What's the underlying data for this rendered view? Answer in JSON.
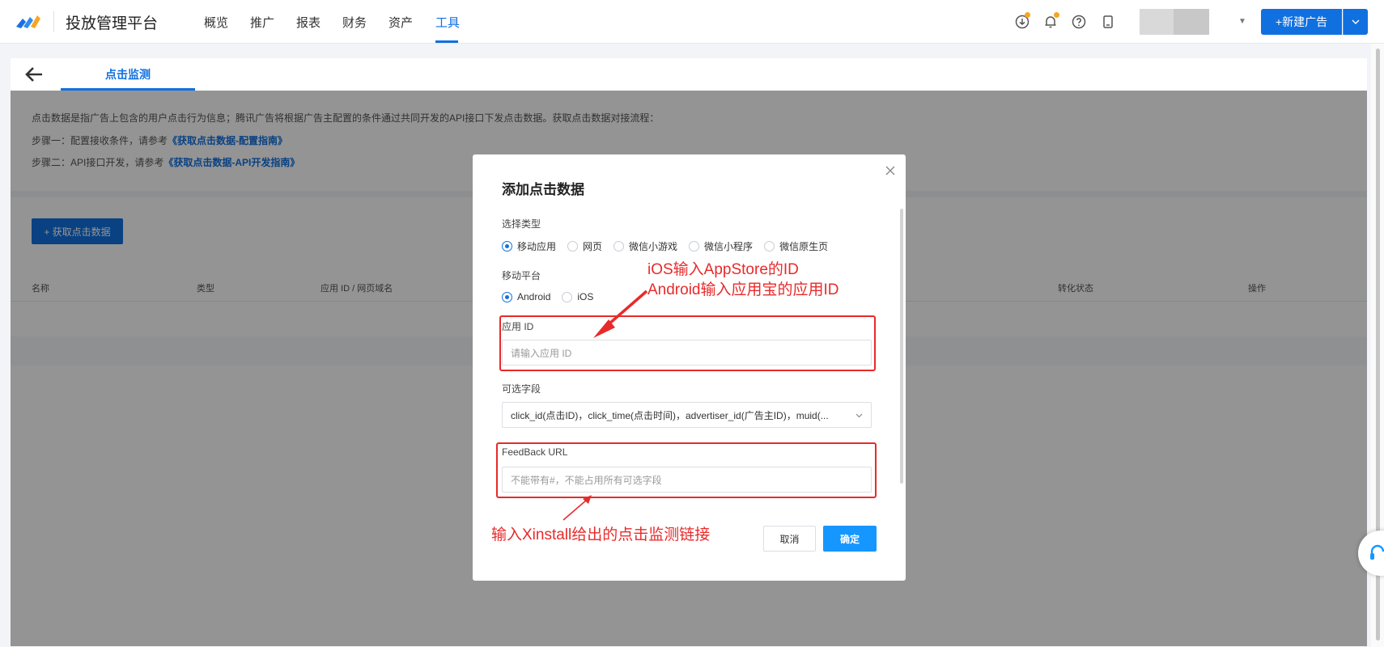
{
  "app": {
    "title": "投放管理平台"
  },
  "nav": {
    "items": [
      {
        "label": "概览"
      },
      {
        "label": "推广"
      },
      {
        "label": "报表"
      },
      {
        "label": "财务"
      },
      {
        "label": "资产"
      },
      {
        "label": "工具"
      }
    ],
    "active": "工具"
  },
  "header_actions": {
    "new_ad_label": "+新建广告"
  },
  "subheader": {
    "tab_label": "点击监测"
  },
  "info": {
    "line1": "点击数据是指广告上包含的用户点击行为信息；腾讯广告将根据广告主配置的条件通过共同开发的API接口下发点击数据。获取点击数据对接流程：",
    "step1_prefix": "步骤一：配置接收条件，请参考",
    "step1_link": "《获取点击数据-配置指南》",
    "step2_prefix": "步骤二：API接口开发，请参考",
    "step2_link": "《获取点击数据-API开发指南》"
  },
  "list": {
    "get_button": "+ 获取点击数据",
    "columns": [
      "名称",
      "类型",
      "应用 ID / 网页域名",
      "转化状态",
      "操作"
    ]
  },
  "modal": {
    "title": "添加点击数据",
    "type_label": "选择类型",
    "type_options": [
      "移动应用",
      "网页",
      "微信小游戏",
      "微信小程序",
      "微信原生页"
    ],
    "type_selected": "移动应用",
    "platform_label": "移动平台",
    "platform_options": [
      "Android",
      "iOS"
    ],
    "platform_selected": "Android",
    "app_id_label": "应用 ID",
    "app_id_placeholder": "请输入应用 ID",
    "fields_label": "可选字段",
    "fields_value": "click_id(点击ID)，click_time(点击时间)，advertiser_id(广告主ID)，muid(...",
    "feedback_label": "FeedBack URL",
    "feedback_placeholder": "不能带有#，不能占用所有可选字段",
    "cancel_label": "取消",
    "ok_label": "确定"
  },
  "annotations": {
    "ios_note": "iOS输入AppStore的ID",
    "android_note": "Android输入应用宝的应用ID",
    "xinstall_note": "输入Xinstall给出的点击监测链接"
  },
  "colors": {
    "accent": "#1170e0",
    "annotation": "#e82a2a",
    "ok_button": "#1597ff"
  }
}
